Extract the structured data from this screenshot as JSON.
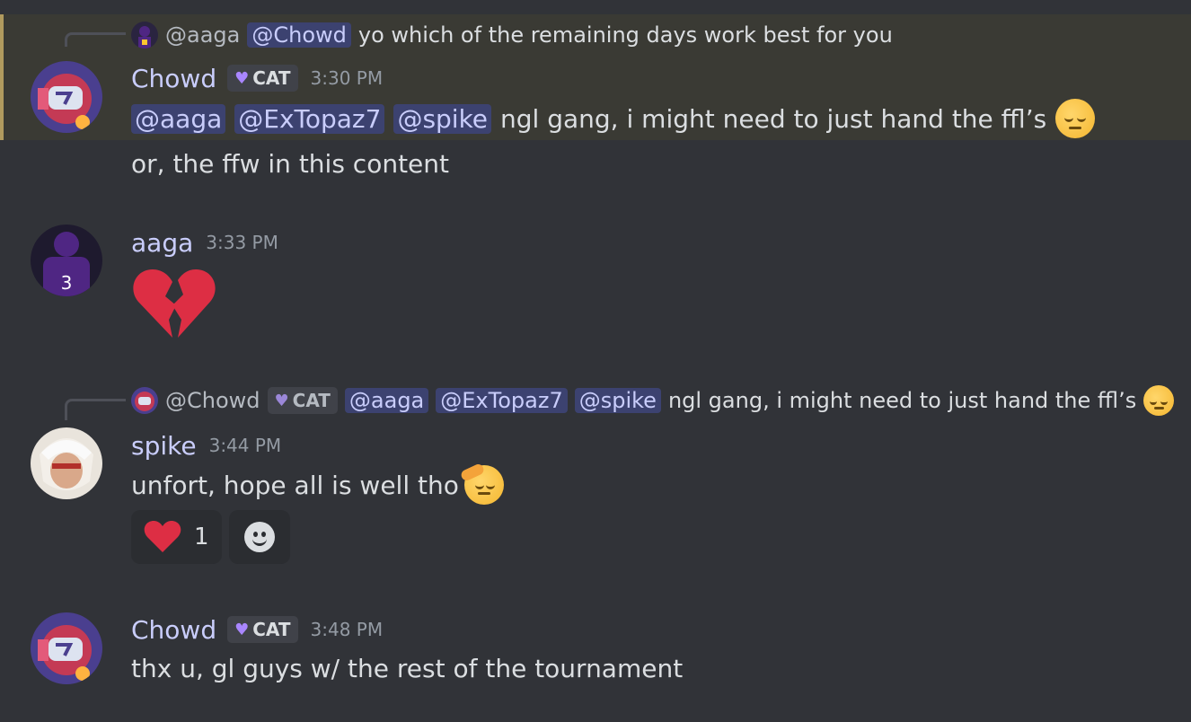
{
  "messages": [
    {
      "reply": {
        "author": "@aaga",
        "mention": "@Chowd",
        "text": "yo which of the remaining days work best for you"
      },
      "author": "Chowd",
      "tag": "CAT",
      "time": "3:30 PM",
      "mentions": [
        "@aaga",
        "@ExTopaz7",
        "@spike"
      ],
      "text": "ngl gang, i might need to just hand the ffl’s",
      "emoji": "pensive-face",
      "followup": "or, the ffw in this content"
    },
    {
      "author": "aaga",
      "time": "3:33 PM",
      "emoji": "broken-heart"
    },
    {
      "reply": {
        "author": "@Chowd",
        "tag": "CAT",
        "mentions": [
          "@aaga",
          "@ExTopaz7",
          "@spike"
        ],
        "text": "ngl gang, i might need to just hand the ffl’s",
        "emoji": "pensive-face"
      },
      "author": "spike",
      "time": "3:44 PM",
      "text": "unfort, hope all is well tho",
      "emoji": "saluting-face",
      "reactions": [
        {
          "emoji": "red-heart",
          "count": "1"
        }
      ]
    },
    {
      "author": "Chowd",
      "tag": "CAT",
      "time": "3:48 PM",
      "text": "thx u, gl guys w/ the rest of the tournament"
    }
  ],
  "colors": {
    "background": "#313338",
    "mention_bg": "#3c4270",
    "highlight_border": "#b09a5e"
  }
}
